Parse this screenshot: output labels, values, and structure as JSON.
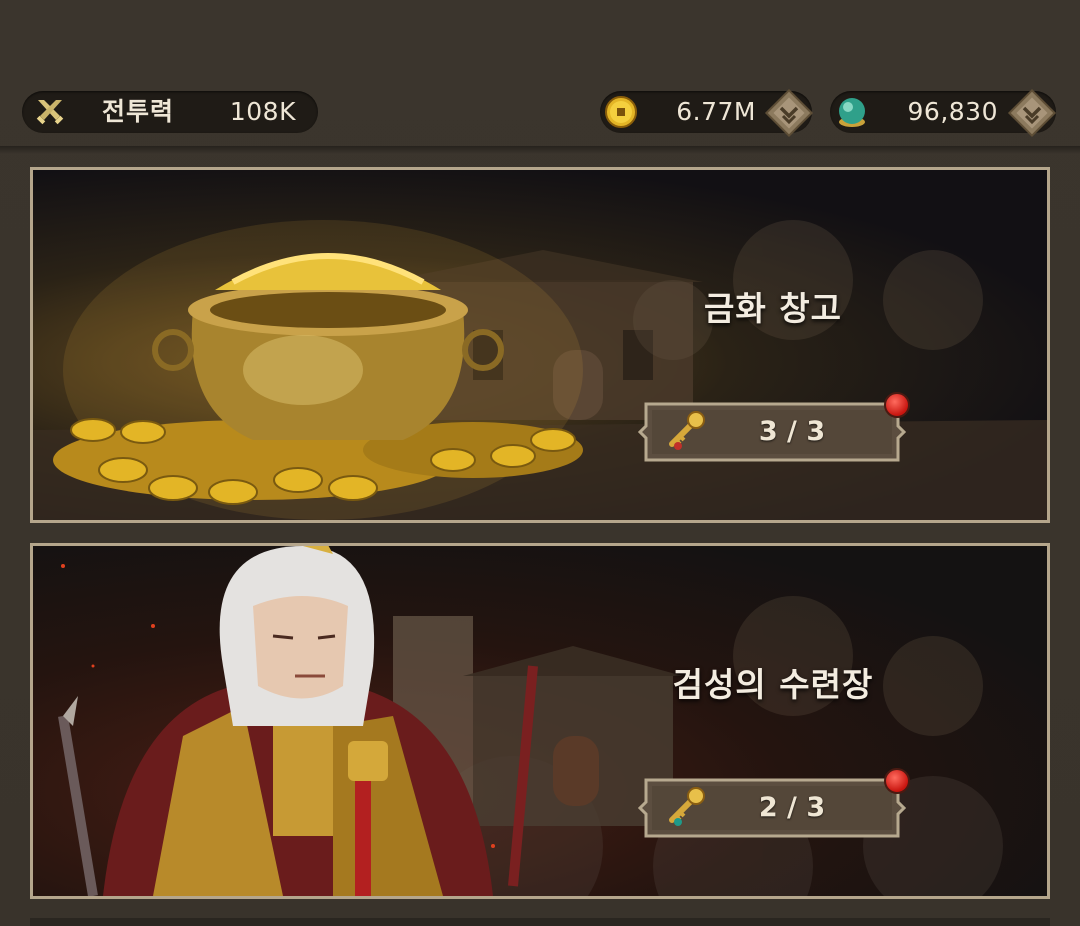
{
  "header": {
    "power": {
      "label": "전투력",
      "value": "108K",
      "icon": "crossed-swords-icon"
    },
    "gold": {
      "value": "6.77M",
      "icon": "gold-coin-icon"
    },
    "jade": {
      "value": "96,830",
      "icon": "jade-orb-icon"
    }
  },
  "banners": [
    {
      "title": "금화 창고",
      "count": "3 / 3",
      "icon": "gold-key-icon",
      "has_notification": true
    },
    {
      "title": "검성의 수련장",
      "count": "2 / 3",
      "icon": "jade-key-icon",
      "has_notification": true
    }
  ],
  "colors": {
    "background": "#3a342c",
    "pill": "#1f1b16",
    "banner_border": "#b5a68c",
    "notification": "#d11a12",
    "text": "#f3ece0"
  }
}
